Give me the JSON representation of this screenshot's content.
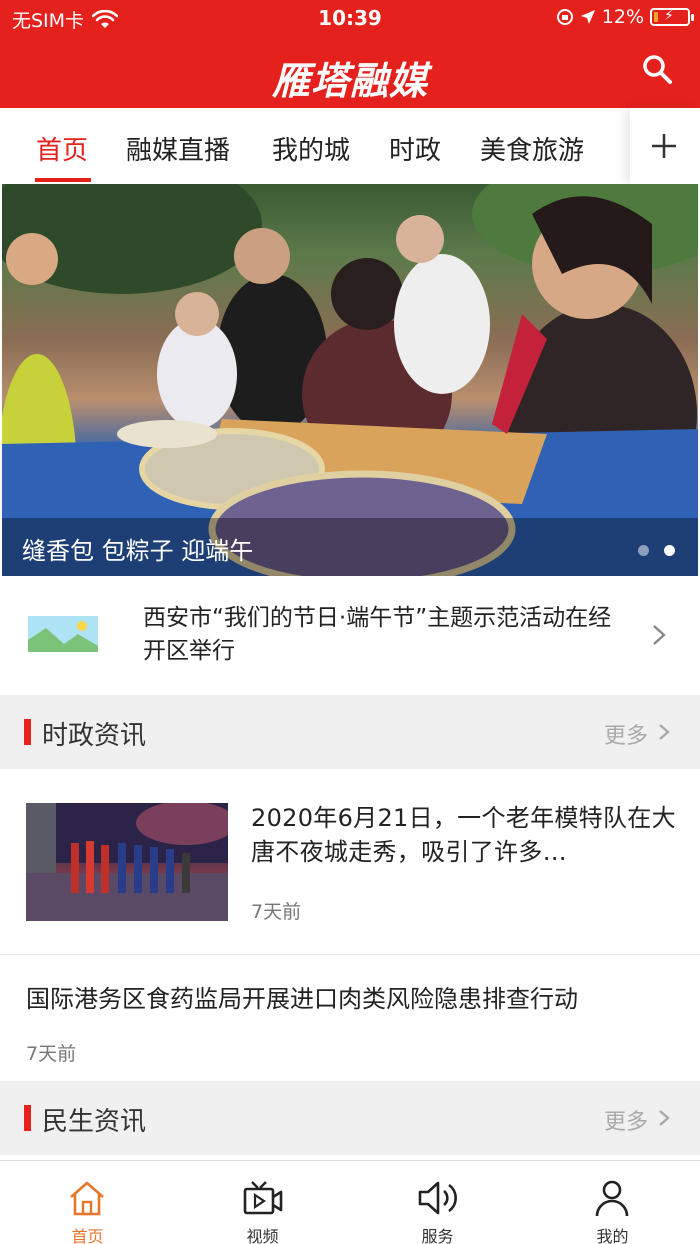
{
  "status_bar": {
    "carrier": "无SIM卡",
    "time": "10:39",
    "battery_percent": "12%",
    "battery_level": 0.12
  },
  "header": {
    "title": "雁塔融媒"
  },
  "tabs": [
    {
      "label": "首页",
      "active": true
    },
    {
      "label": "融媒直播",
      "active": false
    },
    {
      "label": "我的城",
      "active": false
    },
    {
      "label": "时政",
      "active": false
    },
    {
      "label": "美食旅游",
      "active": false
    }
  ],
  "banner": {
    "caption": "缝香包 包粽子 迎端午",
    "slide_count": 2,
    "active_slide": 2
  },
  "headline": {
    "text": "西安市“我们的节日·端午节”主题示范活动在经开区举行"
  },
  "sections": {
    "politics": {
      "title": "时政资讯",
      "more": "更多"
    },
    "livelihood": {
      "title": "民生资讯",
      "more": "更多"
    }
  },
  "news": [
    {
      "title": "2020年6月21日，一个老年模特队在大唐不夜城走秀，吸引了许多…",
      "time": "7天前"
    },
    {
      "title": "国际港务区食药监局开展进口肉类风险隐患排查行动",
      "time": "7天前"
    }
  ],
  "bottom_nav": [
    {
      "label": "首页",
      "icon": "home-icon",
      "active": true
    },
    {
      "label": "视频",
      "icon": "video-icon",
      "active": false
    },
    {
      "label": "服务",
      "icon": "speaker-icon",
      "active": false
    },
    {
      "label": "我的",
      "icon": "user-icon",
      "active": false
    }
  ],
  "colors": {
    "brand_red": "#e4211c",
    "nav_active": "#e8762a",
    "battery_low": "#f5a623"
  }
}
